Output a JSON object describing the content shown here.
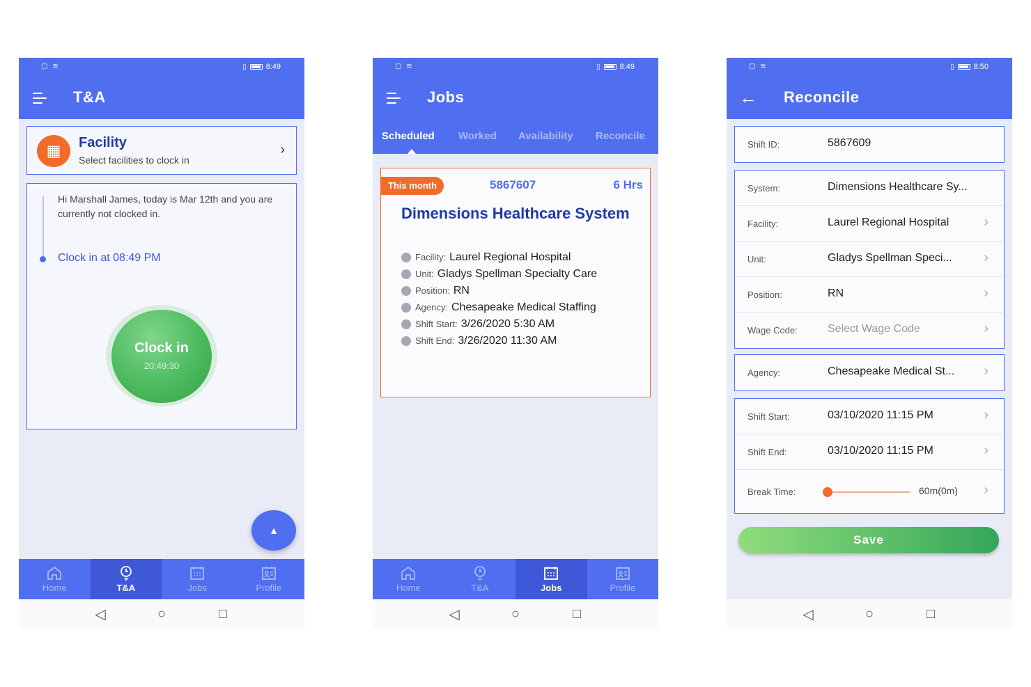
{
  "colors": {
    "primary": "#4f6ef0",
    "primary_dark": "#3e58d8",
    "accent_orange": "#f26b2a",
    "green": "#4cba5e",
    "title_blue": "#1f3aa8"
  },
  "nav_labels": {
    "home": "Home",
    "ta": "T&A",
    "jobs": "Jobs",
    "profile": "Profile"
  },
  "screen1": {
    "status_time": "8:49",
    "title": "T&A",
    "facility": {
      "title": "Facility",
      "subtitle": "Select facilities to clock in"
    },
    "greeting": "Hi Marshall James, today is Mar 12th and you are currently not clocked in.",
    "clock_in_at": "Clock in at 08:49 PM",
    "clock_button": {
      "label": "Clock in",
      "time": "20:49:30"
    },
    "active_nav": "ta"
  },
  "screen2": {
    "status_time": "8:49",
    "title": "Jobs",
    "tabs": [
      "Scheduled",
      "Worked",
      "Availability",
      "Reconcile"
    ],
    "active_tab": 0,
    "job": {
      "badge": "This month",
      "id": "5867607",
      "hours": "6 Hrs",
      "title": "Dimensions Healthcare System",
      "rows": [
        {
          "label": "Facility:",
          "value": "Laurel Regional Hospital"
        },
        {
          "label": "Unit:",
          "value": "Gladys Spellman Specialty Care"
        },
        {
          "label": "Position:",
          "value": "RN"
        },
        {
          "label": "Agency:",
          "value": "Chesapeake Medical Staffing"
        },
        {
          "label": "Shift Start:",
          "value": "3/26/2020 5:30 AM"
        },
        {
          "label": "Shift End:",
          "value": "3/26/2020 11:30 AM"
        }
      ]
    },
    "active_nav": "jobs"
  },
  "screen3": {
    "status_time": "8:50",
    "title": "Reconcile",
    "shift_id": {
      "label": "Shift ID:",
      "value": "5867609"
    },
    "group1": [
      {
        "label": "System:",
        "value": "Dimensions Healthcare Sy...",
        "chevron": false
      },
      {
        "label": "Facility:",
        "value": "Laurel Regional Hospital",
        "chevron": true
      },
      {
        "label": "Unit:",
        "value": "Gladys Spellman Speci...",
        "chevron": true
      },
      {
        "label": "Position:",
        "value": "RN",
        "chevron": true
      },
      {
        "label": "Wage Code:",
        "placeholder": "Select Wage Code",
        "chevron": true
      }
    ],
    "agency": {
      "label": "Agency:",
      "value": "Chesapeake Medical St..."
    },
    "shift_start": {
      "label": "Shift Start:",
      "value": "03/10/2020 11:15 PM"
    },
    "shift_end": {
      "label": "Shift End:",
      "value": "03/10/2020 11:15 PM"
    },
    "break_time": {
      "label": "Break Time:",
      "value": "60m(0m)",
      "slider_fraction": 0
    },
    "save": "Save"
  },
  "system_nav": {
    "back": "◁",
    "home": "○",
    "recent": "□"
  }
}
